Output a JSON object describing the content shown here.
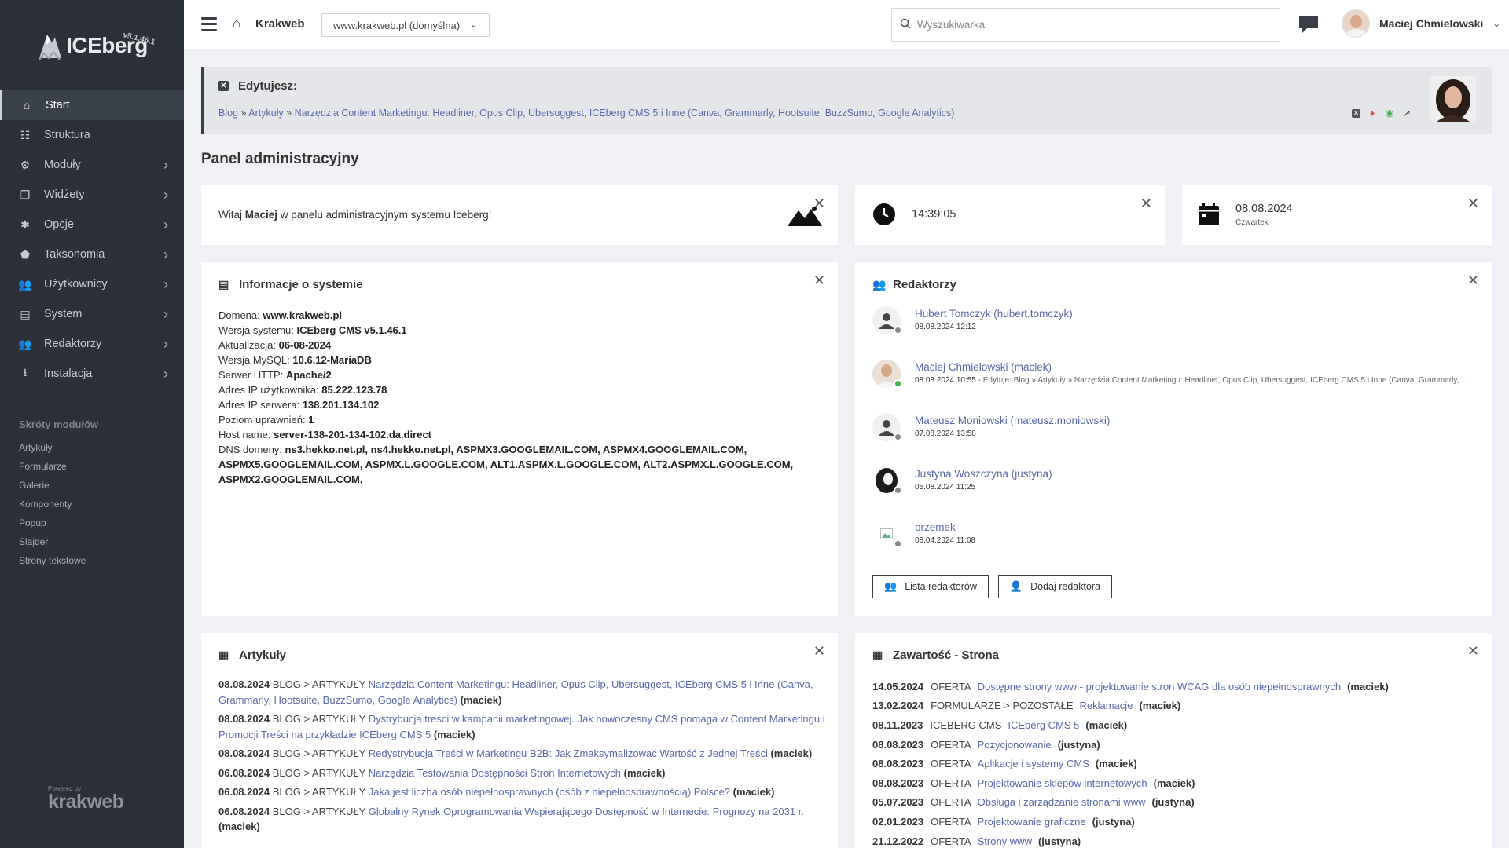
{
  "sidebar": {
    "logo_text": "ICEberg",
    "logo_version": "v5.1.46.1",
    "items": [
      {
        "label": "Start",
        "icon": "home-icon",
        "active": true
      },
      {
        "label": "Struktura",
        "icon": "structure-icon"
      },
      {
        "label": "Moduły",
        "icon": "modules-icon"
      },
      {
        "label": "Widżety",
        "icon": "widgets-icon"
      },
      {
        "label": "Opcje",
        "icon": "gear-icon"
      },
      {
        "label": "Taksonomia",
        "icon": "tags-icon"
      },
      {
        "label": "Użytkownicy",
        "icon": "users-icon"
      },
      {
        "label": "System",
        "icon": "server-icon"
      },
      {
        "label": "Redaktorzy",
        "icon": "editors-icon"
      },
      {
        "label": "Instalacja",
        "icon": "download-icon"
      }
    ],
    "shortcuts_title": "Skróty modułów",
    "shortcuts": [
      "Artykuły",
      "Formularze",
      "Galerie",
      "Komponenty",
      "Popup",
      "Slajder",
      "Strony tekstowe"
    ],
    "powered_by": "Powered by",
    "powered_brand": "krakweb"
  },
  "topbar": {
    "site_name": "Krakweb",
    "domain_select": "www.krakweb.pl (domyślna)",
    "search_placeholder": "Wyszukiwarka",
    "user_name": "Maciej Chmielowski"
  },
  "edit_bar": {
    "title": "Edytujesz:",
    "crumbs": [
      "Blog",
      "Artykuły",
      "Narzędzia Content Marketingu: Headliner, Opus Clip, Ubersuggest, ICEberg CMS 5 i Inne (Canva, Grammarly, Hootsuite, BuzzSumo, Google Analytics)"
    ],
    "separator": "»"
  },
  "page_title": "Panel administracyjny",
  "welcome": {
    "before": "Witaj ",
    "name": "Maciej",
    "after": " w panelu administracyjnym systemu Iceberg!"
  },
  "clock": {
    "time": "14:39:05"
  },
  "date": {
    "value": "08.08.2024",
    "day": "Czwartek"
  },
  "sysinfo": {
    "title": "Informacje o systemie",
    "lines": [
      {
        "label": "Domena: ",
        "value": "www.krakweb.pl"
      },
      {
        "label": "Wersja systemu: ",
        "value": "ICEberg CMS v5.1.46.1"
      },
      {
        "label": "Aktualizacja: ",
        "value": "06-08-2024"
      },
      {
        "label": "Wersja MySQL: ",
        "value": "10.6.12-MariaDB"
      },
      {
        "label": "Serwer HTTP: ",
        "value": "Apache/2"
      },
      {
        "label": "Adres IP użytkownika: ",
        "value": "85.222.123.78"
      },
      {
        "label": "Adres IP serwera: ",
        "value": "138.201.134.102"
      },
      {
        "label": "Poziom uprawnień: ",
        "value": "1"
      },
      {
        "label": "Host name: ",
        "value": "server-138-201-134-102.da.direct"
      },
      {
        "label": "DNS domeny: ",
        "value": "ns3.hekko.net.pl, ns4.hekko.net.pl, ASPMX3.GOOGLEMAIL.COM, ASPMX4.GOOGLEMAIL.COM, ASPMX5.GOOGLEMAIL.COM, ASPMX.L.GOOGLE.COM, ALT1.ASPMX.L.GOOGLE.COM, ALT2.ASPMX.L.GOOGLE.COM, ASPMX2.GOOGLEMAIL.COM,"
      }
    ]
  },
  "editors": {
    "title": "Redaktorzy",
    "list": [
      {
        "name": "Hubert Tomczyk (hubert.tomczyk)",
        "date": "08.08.2024 12:12",
        "activity": "",
        "online": false,
        "avatar": "person"
      },
      {
        "name": "Maciej Chmielowski (maciek)",
        "date": "08.08.2024 10:55",
        "activity": " - Edytuje: Blog » Artykuły » Narzędzia Content Marketingu: Headliner, Opus Clip, Ubersuggest, ICEberg CMS 5 i Inne (Canva, Grammarly, Hootsuite, BuzzSumo, Google Analytics)",
        "online": true,
        "avatar": "photo"
      },
      {
        "name": "Mateusz Moniowski (mateusz.moniowski)",
        "date": "07.08.2024 13:58",
        "activity": "",
        "online": false,
        "avatar": "person"
      },
      {
        "name": "Justyna Woszczyna (justyna)",
        "date": "05.08.2024 11:25",
        "activity": "",
        "online": false,
        "avatar": "photo-dark"
      },
      {
        "name": "przemek",
        "date": "08.04.2024 11:08",
        "activity": "",
        "online": false,
        "avatar": "broken"
      }
    ],
    "btn_list": "Lista redaktorów",
    "btn_add": "Dodaj redaktora"
  },
  "articles": {
    "title": "Artykuły",
    "items": [
      {
        "date": "08.08.2024",
        "cat": "BLOG > ARTYKUŁY",
        "title": "Narzędzia Content Marketingu: Headliner, Opus Clip, Ubersuggest, ICEberg CMS 5 i Inne (Canva, Grammarly, Hootsuite, BuzzSumo, Google Analytics)",
        "author": "(maciek)"
      },
      {
        "date": "08.08.2024",
        "cat": "BLOG > ARTYKUŁY",
        "title": "Dystrybucja treści w kampanii marketingowej. Jak nowoczesny CMS pomaga w Content Marketingu i Promocji Treści na przykładzie ICEberg CMS 5",
        "author": "(maciek)"
      },
      {
        "date": "08.08.2024",
        "cat": "BLOG > ARTYKUŁY",
        "title": "Redystrybucja Treści w Marketingu B2B: Jak Zmaksymalizować Wartość z Jednej Treści",
        "author": "(maciek)"
      },
      {
        "date": "06.08.2024",
        "cat": "BLOG > ARTYKUŁY",
        "title": "Narzędzia Testowania Dostępności Stron Internetowych",
        "author": "(maciek)"
      },
      {
        "date": "06.08.2024",
        "cat": "BLOG > ARTYKUŁY",
        "title": "Jaka jest liczba osób niepełnosprawnych (osób z niepełnosprawnością) Polsce?",
        "author": "(maciek)"
      },
      {
        "date": "06.08.2024",
        "cat": "BLOG > ARTYKUŁY",
        "title": "Globalny Rynek Oprogramowania Wspierającego Dostępność w Internecie: Prognozy na 2031 r.",
        "author": "(maciek)"
      }
    ]
  },
  "content": {
    "title": "Zawartość - Strona",
    "items": [
      {
        "date": "14.05.2024",
        "cat": "OFERTA",
        "title": "Dostępne strony www - projektowanie stron WCAG dla osób niepełnosprawnych",
        "author": "(maciek)"
      },
      {
        "date": "13.02.2024",
        "cat": "FORMULARZE > POZOSTAŁE",
        "title": "Reklamacje",
        "author": "(maciek)"
      },
      {
        "date": "08.11.2023",
        "cat": "ICEBERG CMS",
        "title": "ICEberg CMS 5",
        "author": "(maciek)"
      },
      {
        "date": "08.08.2023",
        "cat": "OFERTA",
        "title": "Pozycjonowanie",
        "author": "(justyna)"
      },
      {
        "date": "08.08.2023",
        "cat": "OFERTA",
        "title": "Aplikacje i systemy CMS",
        "author": "(maciek)"
      },
      {
        "date": "08.08.2023",
        "cat": "OFERTA",
        "title": "Projektowanie sklepów internetowych",
        "author": "(maciek)"
      },
      {
        "date": "05.07.2023",
        "cat": "OFERTA",
        "title": "Obsługa i zarządzanie stronami www",
        "author": "(justyna)"
      },
      {
        "date": "02.01.2023",
        "cat": "OFERTA",
        "title": "Projektowanie graficzne",
        "author": "(justyna)"
      },
      {
        "date": "21.12.2022",
        "cat": "OFERTA",
        "title": "Strony www",
        "author": "(justyna)"
      }
    ]
  },
  "colors": {
    "sidebar": "#2c3139",
    "link": "#5b69a9",
    "online": "#4caf50"
  }
}
